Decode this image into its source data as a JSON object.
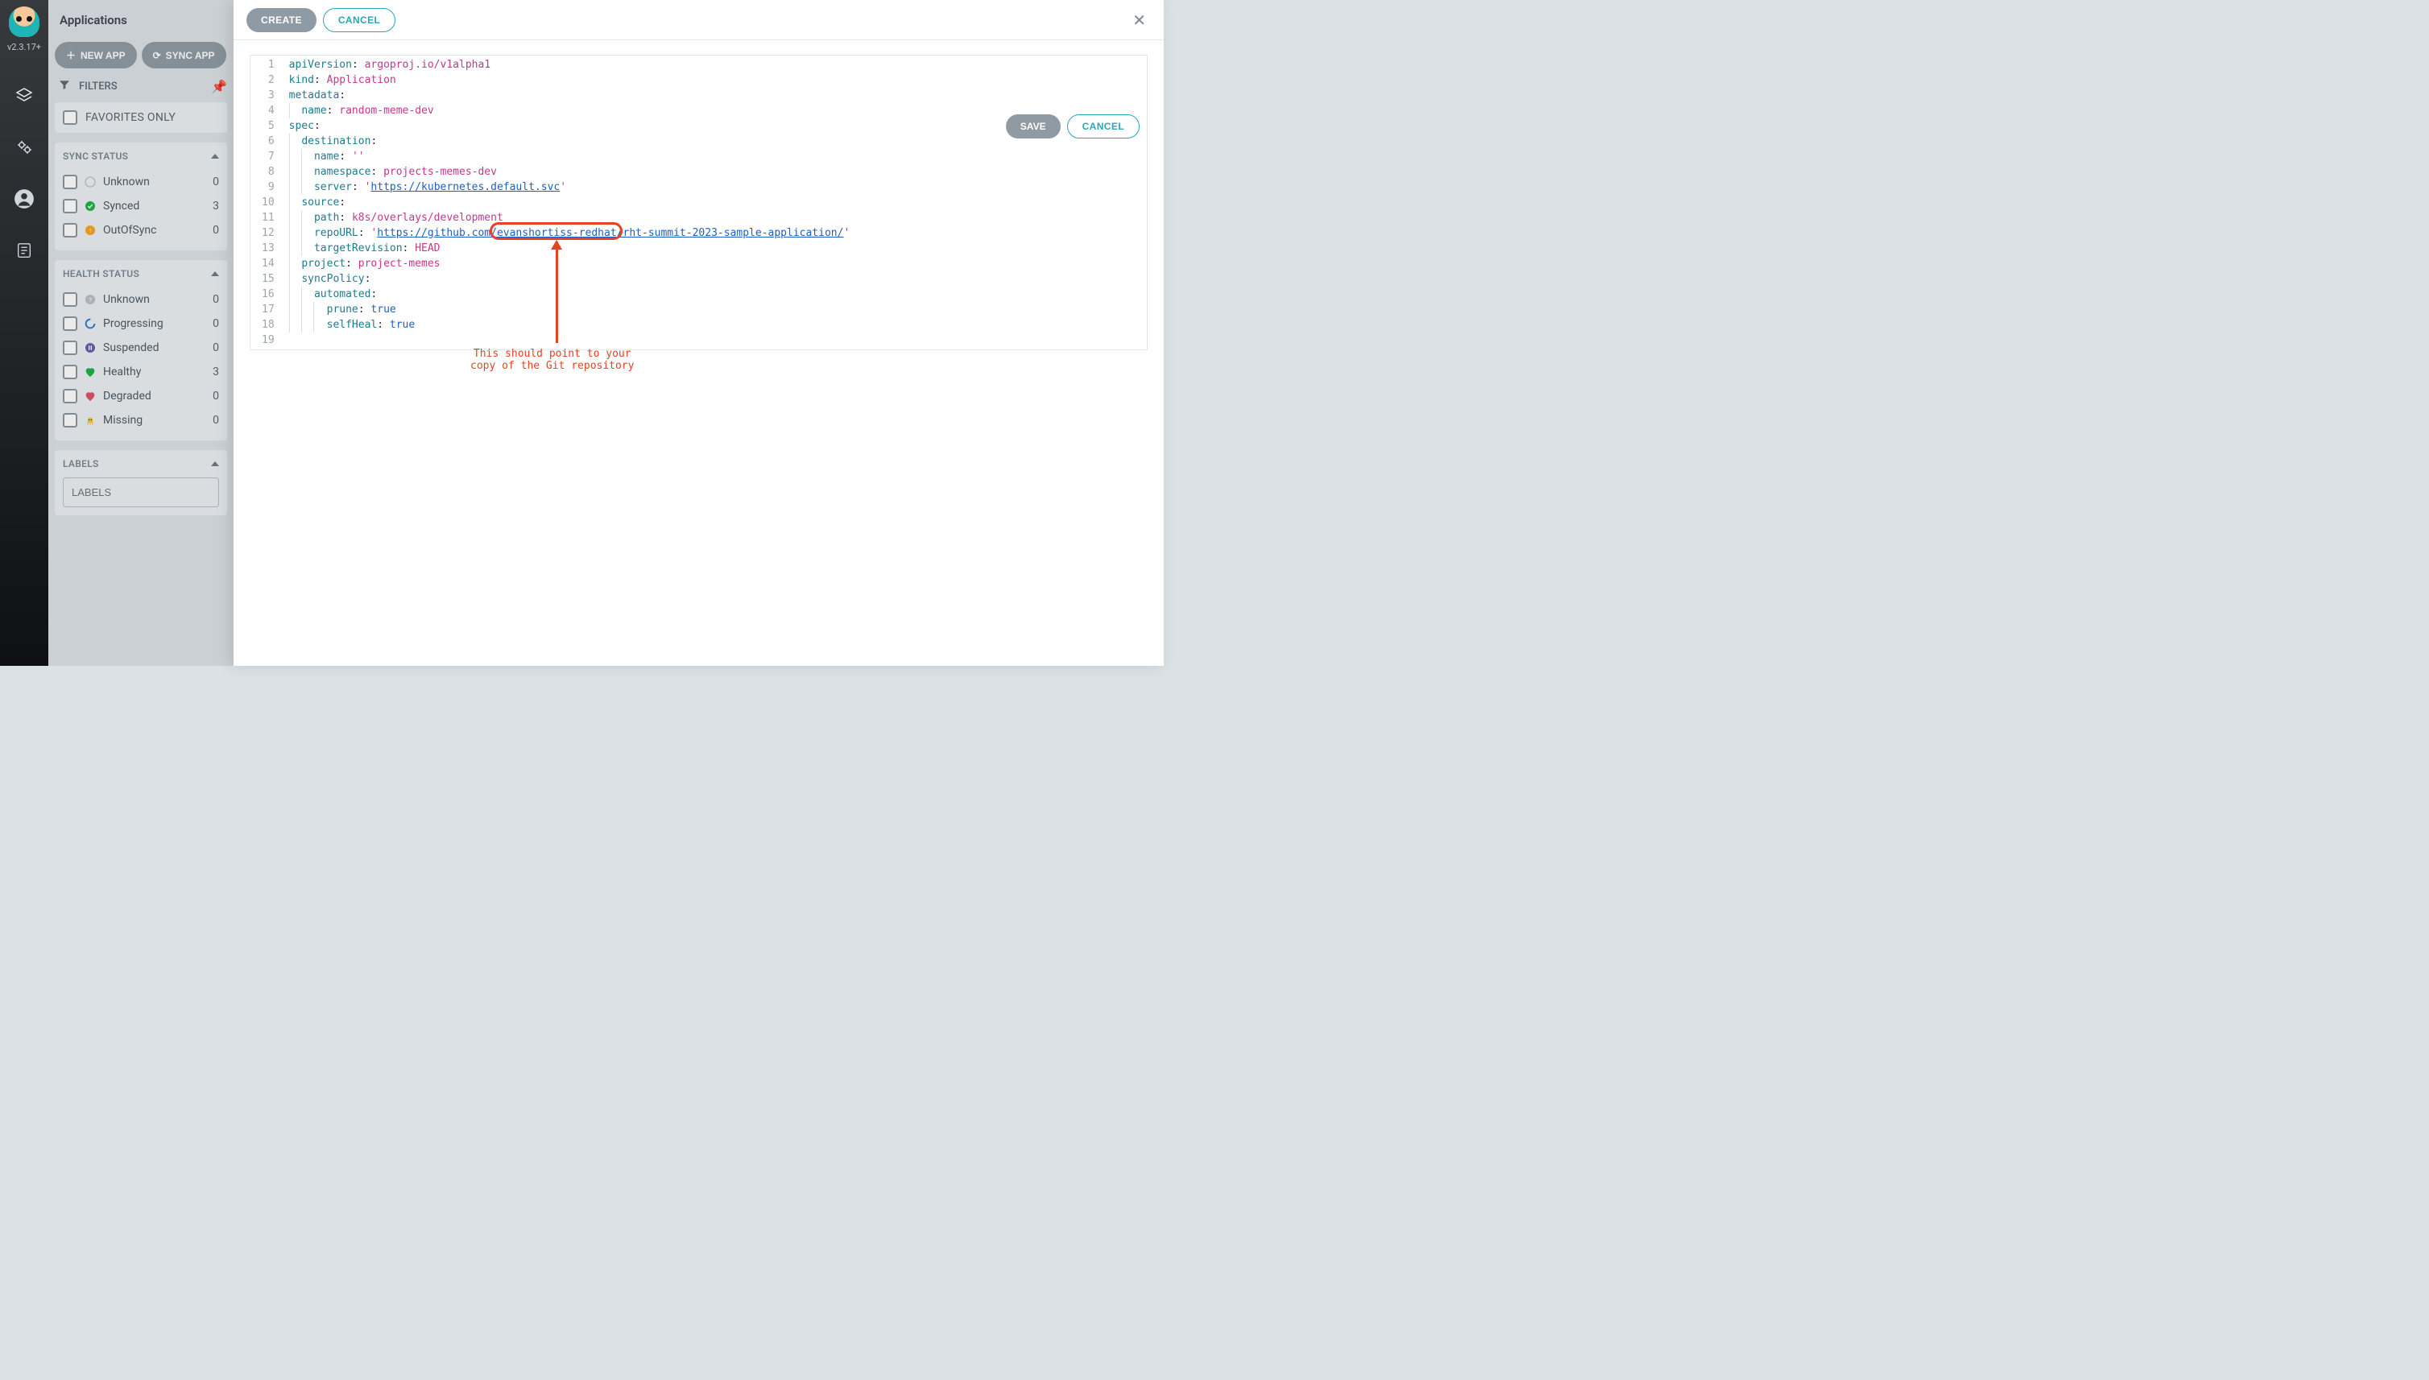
{
  "version": "v2.3.17+",
  "page_title": "Applications",
  "toolbar": {
    "new_app": "NEW APP",
    "sync_apps": "SYNC APP"
  },
  "filters_label": "FILTERS",
  "favorites_label": "FAVORITES ONLY",
  "sync_status": {
    "title": "SYNC STATUS",
    "rows": [
      {
        "icon": "question",
        "label": "Unknown",
        "count": 0
      },
      {
        "icon": "synced",
        "label": "Synced",
        "count": 3
      },
      {
        "icon": "outofsync",
        "label": "OutOfSync",
        "count": 0
      }
    ]
  },
  "health_status": {
    "title": "HEALTH STATUS",
    "rows": [
      {
        "icon": "question-grey",
        "label": "Unknown",
        "count": 0
      },
      {
        "icon": "progressing",
        "label": "Progressing",
        "count": 0
      },
      {
        "icon": "suspended",
        "label": "Suspended",
        "count": 0
      },
      {
        "icon": "healthy",
        "label": "Healthy",
        "count": 3
      },
      {
        "icon": "degraded",
        "label": "Degraded",
        "count": 0
      },
      {
        "icon": "missing",
        "label": "Missing",
        "count": 0
      }
    ]
  },
  "labels_section": {
    "title": "LABELS",
    "placeholder": "LABELS"
  },
  "modal": {
    "create": "CREATE",
    "cancel": "CANCEL",
    "save": "SAVE",
    "cancel2": "CANCEL"
  },
  "yaml": {
    "lines": [
      {
        "n": 1,
        "indent": 0,
        "key": "apiVersion",
        "val": "argoproj.io/v1alpha1",
        "type": "val"
      },
      {
        "n": 2,
        "indent": 0,
        "key": "kind",
        "val": "Application",
        "type": "val"
      },
      {
        "n": 3,
        "indent": 0,
        "key": "metadata",
        "val": "",
        "type": "colon"
      },
      {
        "n": 4,
        "indent": 1,
        "key": "name",
        "val": "random-meme-dev",
        "type": "val"
      },
      {
        "n": 5,
        "indent": 0,
        "key": "spec",
        "val": "",
        "type": "colon"
      },
      {
        "n": 6,
        "indent": 1,
        "key": "destination",
        "val": "",
        "type": "colon"
      },
      {
        "n": 7,
        "indent": 2,
        "key": "name",
        "val": "''",
        "type": "raw"
      },
      {
        "n": 8,
        "indent": 2,
        "key": "namespace",
        "val": "projects-memes-dev",
        "type": "val"
      },
      {
        "n": 9,
        "indent": 2,
        "key": "server",
        "val": "https://kubernetes.default.svc",
        "type": "qurl"
      },
      {
        "n": 10,
        "indent": 1,
        "key": "source",
        "val": "",
        "type": "colon"
      },
      {
        "n": 11,
        "indent": 2,
        "key": "path",
        "val": "k8s/overlays/development",
        "type": "val"
      },
      {
        "n": 12,
        "indent": 2,
        "key": "repoURL",
        "val": "https://github.com/evanshortiss-redhat/rht-summit-2023-sample-application/",
        "type": "qurl"
      },
      {
        "n": 13,
        "indent": 2,
        "key": "targetRevision",
        "val": "HEAD",
        "type": "val"
      },
      {
        "n": 14,
        "indent": 1,
        "key": "project",
        "val": "project-memes",
        "type": "val"
      },
      {
        "n": 15,
        "indent": 1,
        "key": "syncPolicy",
        "val": "",
        "type": "colon"
      },
      {
        "n": 16,
        "indent": 2,
        "key": "automated",
        "val": "",
        "type": "colon"
      },
      {
        "n": 17,
        "indent": 3,
        "key": "prune",
        "val": "true",
        "type": "bool"
      },
      {
        "n": 18,
        "indent": 3,
        "key": "selfHeal",
        "val": "true",
        "type": "bool"
      },
      {
        "n": 19,
        "indent": 0,
        "key": "",
        "val": "",
        "type": "blank"
      }
    ]
  },
  "annotation": {
    "text": "This should point to your\ncopy of the Git repository"
  }
}
